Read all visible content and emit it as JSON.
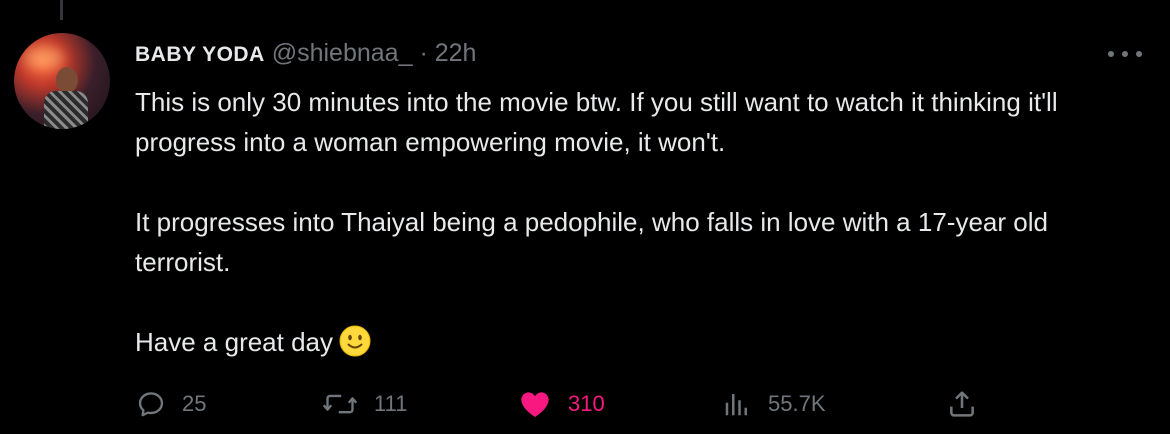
{
  "tweet": {
    "author": {
      "display_name": "BABY YODA",
      "handle": "@shiebnaa_",
      "separator": "·",
      "time": "22h"
    },
    "paragraphs": [
      "This is only 30 minutes into the movie btw. If you still want to watch it thinking it'll progress into a woman empowering movie, it won't.",
      "It progresses into Thaiyal being a pedophile, who falls in love with a 17-year old terrorist.",
      "Have a great day"
    ],
    "emoji": "slightly-smiling-face",
    "actions": {
      "replies": "25",
      "retweets": "111",
      "likes": "310",
      "views": "55.7K"
    },
    "colors": {
      "background": "#000000",
      "text": "#e7e9ea",
      "muted": "#71767b",
      "like": "#f91880",
      "thread_line": "#333639"
    },
    "icons": [
      "more-icon",
      "reply-icon",
      "retweet-icon",
      "heart-icon",
      "views-icon",
      "share-icon"
    ]
  }
}
